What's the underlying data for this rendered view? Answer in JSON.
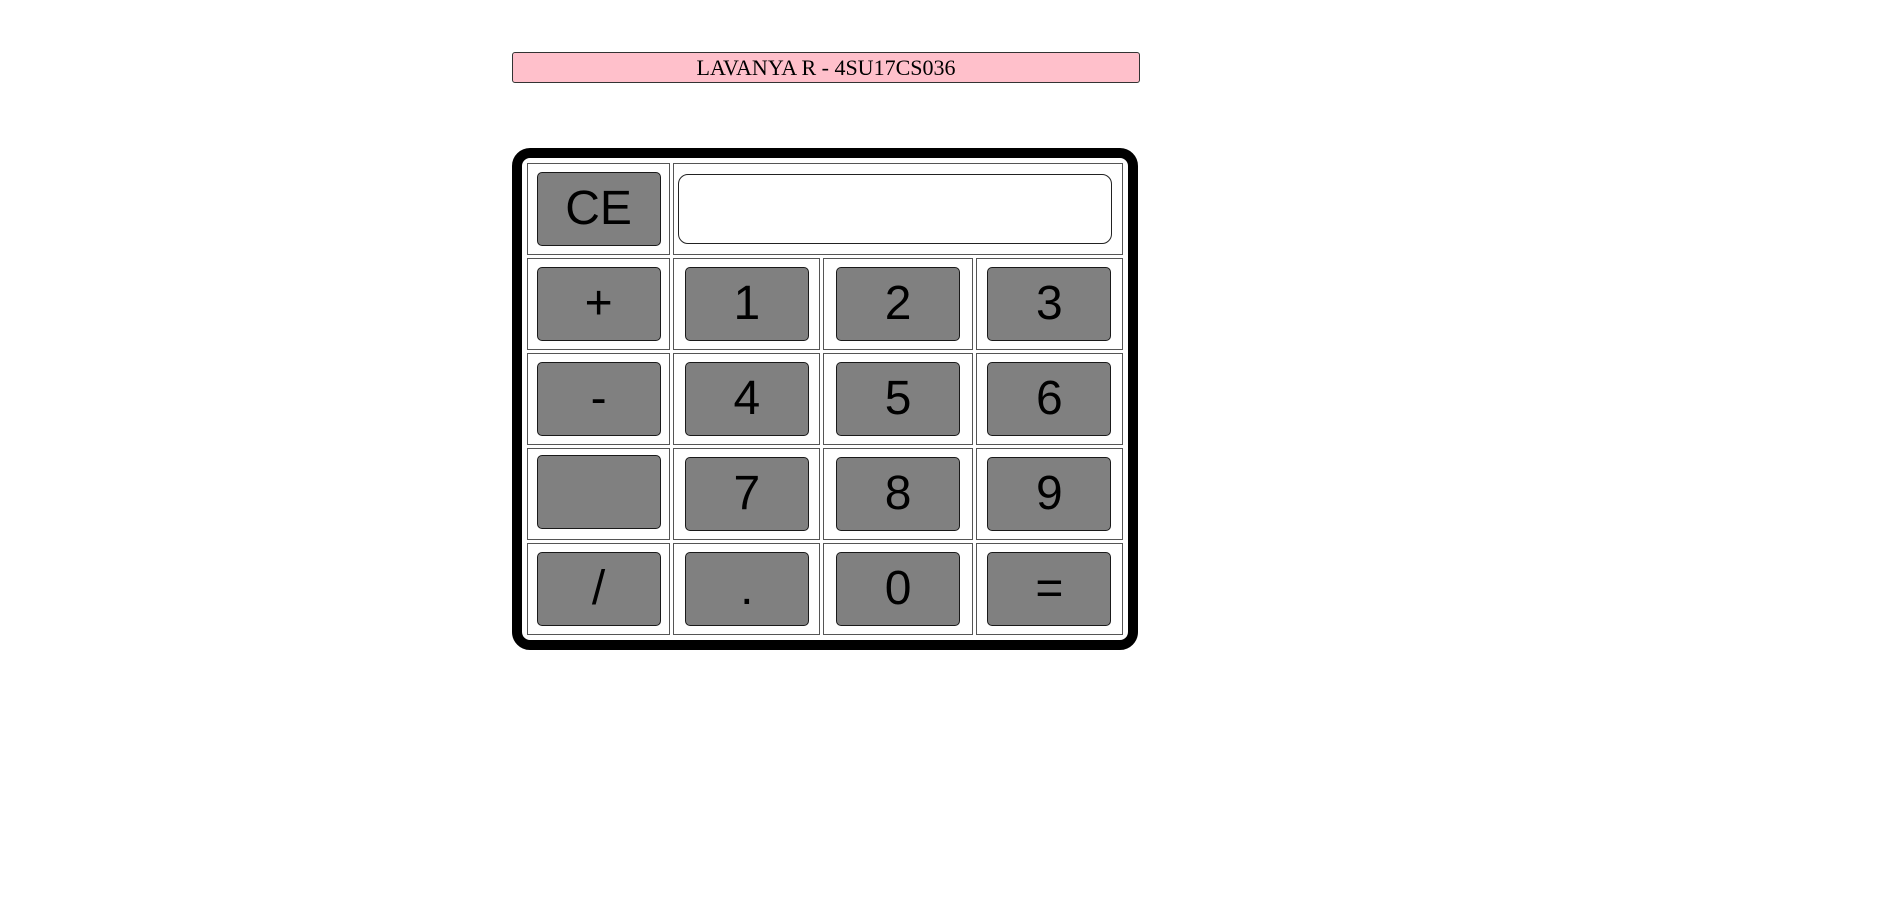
{
  "header": {
    "title": "LAVANYA R - 4SU17CS036"
  },
  "calculator": {
    "display": {
      "value": "",
      "placeholder": ""
    },
    "buttons": {
      "clear": "CE",
      "plus": "+",
      "one": "1",
      "two": "2",
      "three": "3",
      "minus": "-",
      "four": "4",
      "five": "5",
      "six": "6",
      "blank": "",
      "seven": "7",
      "eight": "8",
      "nine": "9",
      "divide": "/",
      "dot": ".",
      "zero": "0",
      "equals": "="
    }
  },
  "colors": {
    "title_background": "#ffc0cb",
    "button_background": "#808080",
    "frame_border": "#000000"
  }
}
